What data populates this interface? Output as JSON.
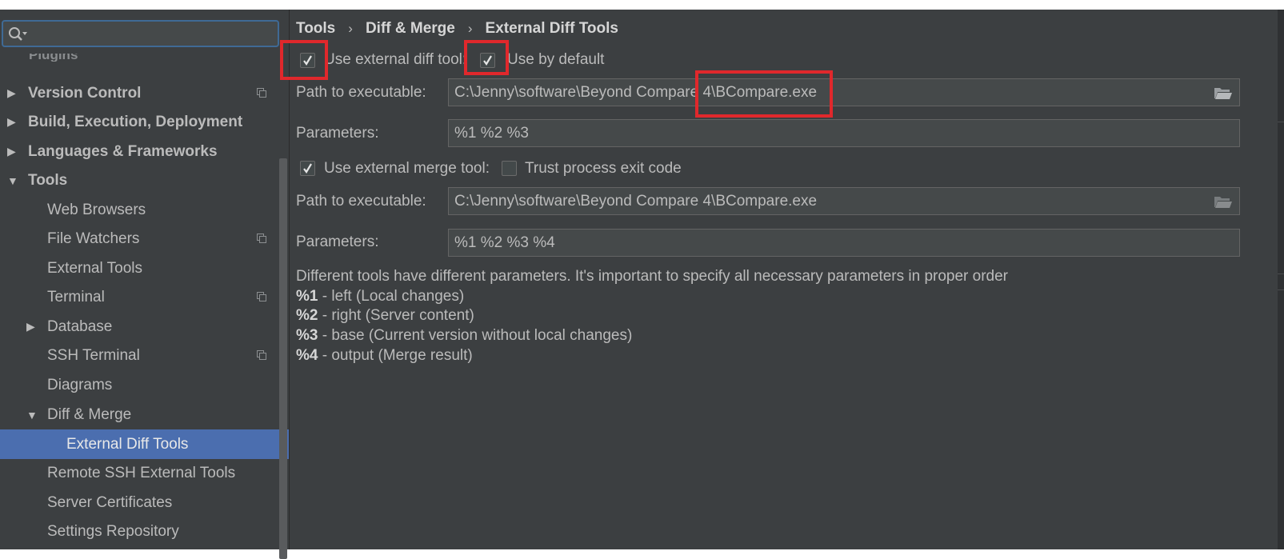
{
  "sidebar": {
    "search": {
      "placeholder": "",
      "value": ""
    },
    "cut_item": "Plugins",
    "items": [
      {
        "label": "Version Control",
        "bold": true,
        "expander": "collapsed",
        "indent": 0,
        "copy": true
      },
      {
        "label": "Build, Execution, Deployment",
        "bold": true,
        "expander": "collapsed",
        "indent": 0,
        "copy": false
      },
      {
        "label": "Languages & Frameworks",
        "bold": true,
        "expander": "collapsed",
        "indent": 0,
        "copy": false
      },
      {
        "label": "Tools",
        "bold": true,
        "expander": "expanded",
        "indent": 0,
        "copy": false
      },
      {
        "label": "Web Browsers",
        "bold": false,
        "expander": "none",
        "indent": 1,
        "copy": false
      },
      {
        "label": "File Watchers",
        "bold": false,
        "expander": "none",
        "indent": 1,
        "copy": true
      },
      {
        "label": "External Tools",
        "bold": false,
        "expander": "none",
        "indent": 1,
        "copy": false
      },
      {
        "label": "Terminal",
        "bold": false,
        "expander": "none",
        "indent": 1,
        "copy": true
      },
      {
        "label": "Database",
        "bold": false,
        "expander": "collapsed",
        "indent": 1,
        "copy": false
      },
      {
        "label": "SSH Terminal",
        "bold": false,
        "expander": "none",
        "indent": 1,
        "copy": true
      },
      {
        "label": "Diagrams",
        "bold": false,
        "expander": "none",
        "indent": 1,
        "copy": false
      },
      {
        "label": "Diff & Merge",
        "bold": false,
        "expander": "expanded",
        "indent": 1,
        "copy": false
      },
      {
        "label": "External Diff Tools",
        "bold": false,
        "expander": "none",
        "indent": 2,
        "copy": false,
        "selected": true
      },
      {
        "label": "Remote SSH External Tools",
        "bold": false,
        "expander": "none",
        "indent": 1,
        "copy": false
      },
      {
        "label": "Server Certificates",
        "bold": false,
        "expander": "none",
        "indent": 1,
        "copy": false
      },
      {
        "label": "Settings Repository",
        "bold": false,
        "expander": "none",
        "indent": 1,
        "copy": false
      }
    ]
  },
  "breadcrumb": [
    "Tools",
    "Diff & Merge",
    "External Diff Tools"
  ],
  "diff": {
    "use_external_label": "Use external diff tool:",
    "use_external_checked": true,
    "use_default_label": "Use by default",
    "use_default_checked": true,
    "path_label": "Path to executable:",
    "path_value": "C:\\Jenny\\software\\Beyond Compare 4\\BCompare.exe",
    "params_label": "Parameters:",
    "params_value": "%1 %2 %3"
  },
  "merge": {
    "use_external_label": "Use external merge tool:",
    "use_external_checked": true,
    "trust_exit_label": "Trust process exit code",
    "trust_exit_checked": false,
    "path_label": "Path to executable:",
    "path_value": "C:\\Jenny\\software\\Beyond Compare 4\\BCompare.exe",
    "params_label": "Parameters:",
    "params_value": "%1 %2 %3 %4"
  },
  "help": {
    "intro": "Different tools have different parameters. It's important to specify all necessary parameters in proper order",
    "params": [
      {
        "key": "%1",
        "desc": " - left (Local changes)"
      },
      {
        "key": "%2",
        "desc": " - right (Server content)"
      },
      {
        "key": "%3",
        "desc": " - base (Current version without local changes)"
      },
      {
        "key": "%4",
        "desc": " - output (Merge result)"
      }
    ]
  },
  "colors": {
    "selection": "#4b6eaf",
    "background": "#3c3f41",
    "highlight_box": "#e0282c"
  },
  "icons": {
    "search": "search-icon",
    "copy": "copy-settings-icon",
    "folder": "folder-icon",
    "check": "checkmark-icon"
  }
}
